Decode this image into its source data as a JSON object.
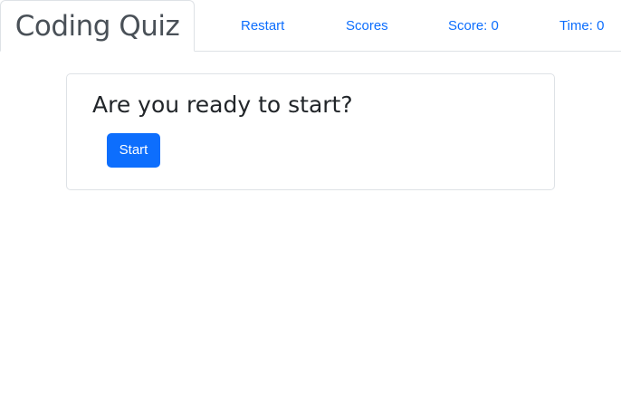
{
  "header": {
    "title": "Coding Quiz",
    "links": {
      "restart": "Restart",
      "scores": "Scores",
      "score": "Score: 0",
      "time": "Time: 0"
    }
  },
  "main": {
    "prompt": "Are you ready to start?",
    "start_label": "Start"
  },
  "colors": {
    "accent": "#0d6efd",
    "title_text": "#495057",
    "body_text": "#212529",
    "border": "#dee2e6"
  }
}
